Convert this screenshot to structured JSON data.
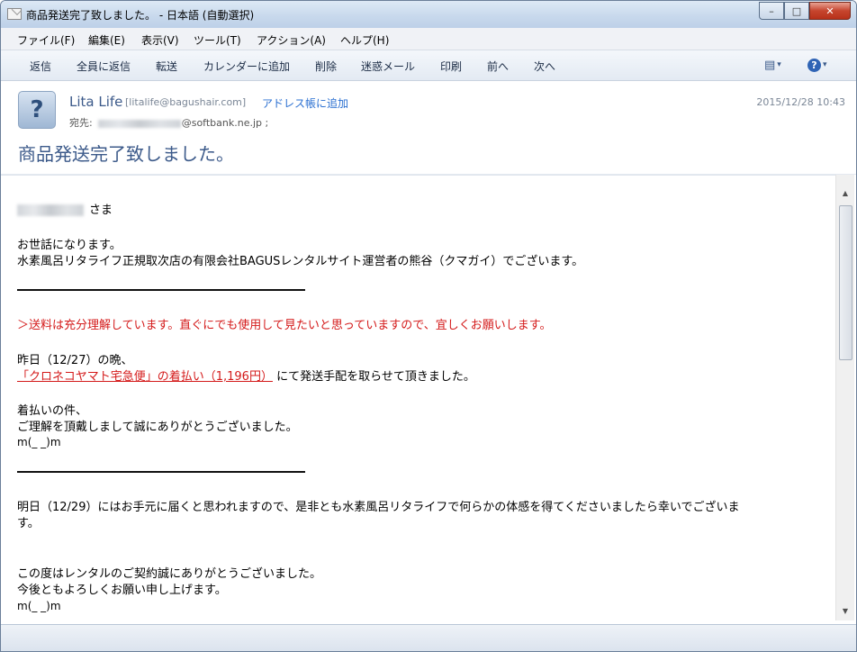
{
  "window": {
    "title": "商品発送完了致しました。 - 日本語 (自動選択)",
    "minimize": "–",
    "maximize": "□",
    "close": "✕"
  },
  "menu": [
    "ファイル(F)",
    "編集(E)",
    "表示(V)",
    "ツール(T)",
    "アクション(A)",
    "ヘルプ(H)"
  ],
  "toolbar": [
    "返信",
    "全員に返信",
    "転送",
    "カレンダーに追加",
    "削除",
    "迷惑メール",
    "印刷",
    "前へ",
    "次へ"
  ],
  "header": {
    "avatar_glyph": "?",
    "sender_name": "Lita Life",
    "sender_email": "[litalife@bagushair.com]",
    "add_to_contacts": "アドレス帳に追加",
    "date": "2015/12/28 10:43",
    "to_label": "宛先:",
    "to_domain": "@softbank.ne.jp ;",
    "subject": "商品発送完了致しました。"
  },
  "body": {
    "salutation_suffix": "さま",
    "greeting": "お世話になります。",
    "intro": "水素風呂リタライフ正規取次店の有限会社BAGUSレンタルサイト運営者の熊谷（クマガイ）でございます。",
    "quote": "＞送料は充分理解しています。直ぐにでも使用して見たいと思っていますので、宜しくお願いします。",
    "yesterday": "昨日（12/27）の晩、",
    "shipping_link": "「クロネコヤマト宅急便」の着払い（1,196円）",
    "shipping_rest": "にて発送手配を取らせて頂きました。",
    "cod1": "着払いの件、",
    "cod2": "ご理解を頂戴しまして誠にありがとうございました。",
    "emote": "m(_ _)m",
    "tomorrow1": "明日（12/29）にはお手元に届くと思われますので、是非とも水素風呂リタライフで何らかの体感を得てくださいましたら幸いでございま",
    "tomorrow2": "す。",
    "thanks1": "この度はレンタルのご契約誠にありがとうございました。",
    "thanks2": "今後ともよろしくお願い申し上げます。",
    "emote2": "m(_ _)m"
  },
  "icons": {
    "view_icon": "▤",
    "help_icon": "?",
    "dropdown": "▾",
    "scroll_up": "▲",
    "scroll_down": "▼"
  }
}
